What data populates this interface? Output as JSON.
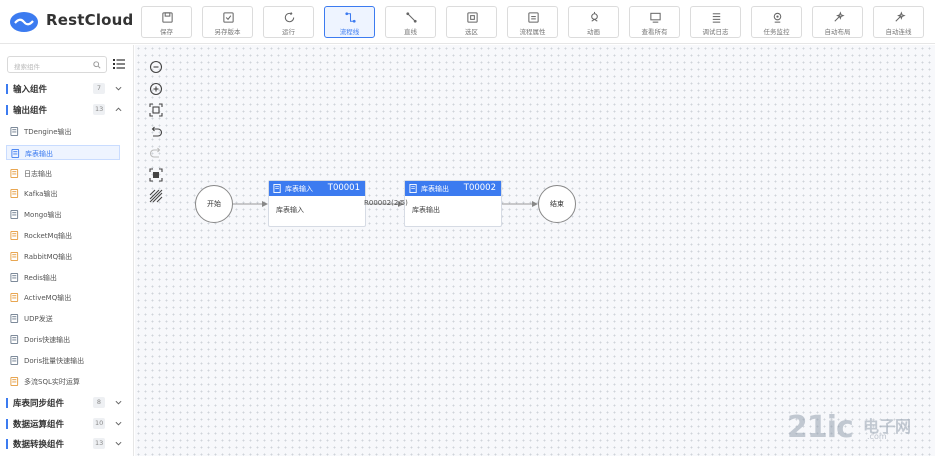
{
  "app": {
    "brand": "RestCloud"
  },
  "toolbar": [
    {
      "label": "保存",
      "icon": "save-icon"
    },
    {
      "label": "另存版本",
      "icon": "save-version-icon"
    },
    {
      "label": "运行",
      "icon": "run-icon"
    },
    {
      "label": "流程线",
      "icon": "flow-line-icon",
      "active": true
    },
    {
      "label": "直线",
      "icon": "straight-line-icon"
    },
    {
      "label": "选区",
      "icon": "selection-icon"
    },
    {
      "label": "流程属性",
      "icon": "flow-properties-icon"
    },
    {
      "label": "动画",
      "icon": "animation-icon"
    },
    {
      "label": "查看所有",
      "icon": "view-all-icon"
    },
    {
      "label": "调试日志",
      "icon": "debug-log-icon"
    },
    {
      "label": "任务监控",
      "icon": "task-monitor-icon"
    },
    {
      "label": "自动布局",
      "icon": "auto-layout-icon"
    },
    {
      "label": "自动连线",
      "icon": "auto-connect-icon"
    }
  ],
  "sidebar": {
    "search_placeholder": "搜索组件",
    "groups_top": [
      {
        "title": "输入组件",
        "count": "7",
        "expanded": false
      },
      {
        "title": "输出组件",
        "count": "13",
        "expanded": true
      }
    ],
    "items": [
      {
        "label": "TDengine输出",
        "icon": "tdengine-icon"
      },
      {
        "label": "库表输出",
        "icon": "table-output-icon",
        "selected": true
      },
      {
        "label": "日志输出",
        "icon": "log-icon"
      },
      {
        "label": "Kafka输出",
        "icon": "kafka-icon"
      },
      {
        "label": "Mongo输出",
        "icon": "mongo-icon"
      },
      {
        "label": "RocketMq输出",
        "icon": "rocketmq-icon"
      },
      {
        "label": "RabbitMQ输出",
        "icon": "rabbitmq-icon"
      },
      {
        "label": "Redis输出",
        "icon": "redis-icon"
      },
      {
        "label": "ActiveMQ输出",
        "icon": "activemq-icon"
      },
      {
        "label": "UDP发送",
        "icon": "udp-icon"
      },
      {
        "label": "Doris快速输出",
        "icon": "doris-icon"
      },
      {
        "label": "Doris批量快速输出",
        "icon": "doris-batch-icon"
      },
      {
        "label": "多流SQL实时运算",
        "icon": "sql-stream-icon"
      }
    ],
    "groups_bottom": [
      {
        "title": "库表同步组件",
        "count": "8",
        "expanded": false
      },
      {
        "title": "数据运算组件",
        "count": "10",
        "expanded": false
      },
      {
        "title": "数据转换组件",
        "count": "13",
        "expanded": false
      }
    ]
  },
  "canvas_tools": [
    {
      "name": "zoom-out-icon"
    },
    {
      "name": "zoom-in-icon"
    },
    {
      "name": "fit-view-icon"
    },
    {
      "name": "undo-icon"
    },
    {
      "name": "redo-icon"
    },
    {
      "name": "fullscreen-icon"
    },
    {
      "name": "grid-toggle-icon"
    }
  ],
  "flow": {
    "start_label": "开始",
    "end_label": "结束",
    "nodes": [
      {
        "title": "库表输入",
        "id": "T00001",
        "body": "库表输入"
      },
      {
        "title": "库表输出",
        "id": "T00002",
        "body": "库表输出"
      }
    ],
    "edge_label": "R00002(2/5)"
  },
  "watermark": {
    "big": "21ic",
    "cn": "电子网",
    "url": ".com"
  },
  "colors": {
    "accent": "#3c7bf0",
    "canvas": "#f7f8fb"
  }
}
